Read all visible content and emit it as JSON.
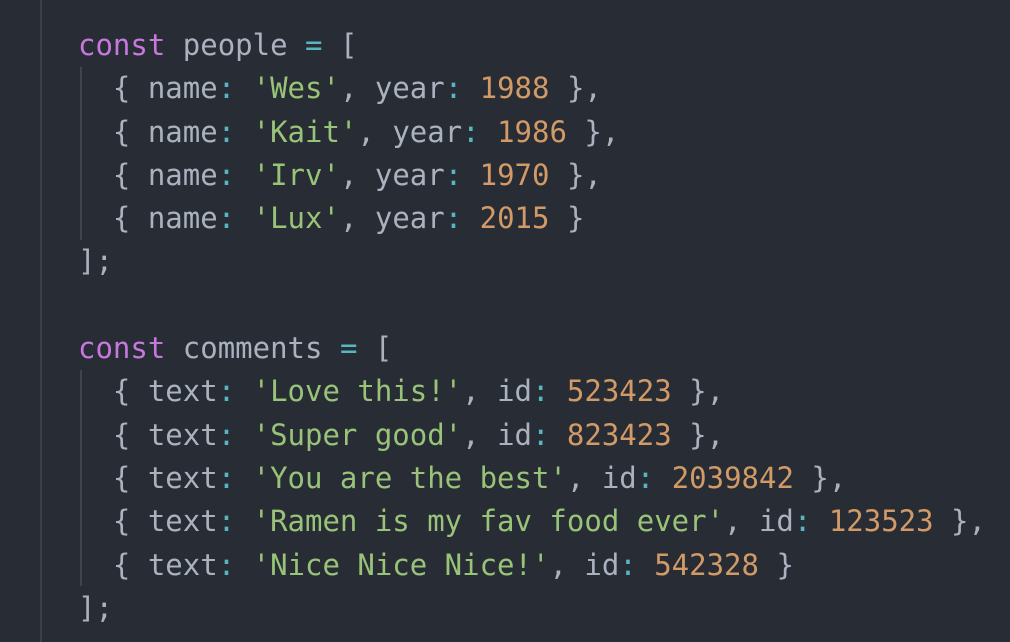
{
  "blocks": [
    {
      "keyword": "const",
      "name": "people",
      "op": "=",
      "open": "[",
      "close": "];",
      "key1": "name",
      "key2": "year",
      "items": [
        {
          "v1": "'Wes'",
          "v2": "1988",
          "end": " },"
        },
        {
          "v1": "'Kait'",
          "v2": "1986",
          "end": " },"
        },
        {
          "v1": "'Irv'",
          "v2": "1970",
          "end": " },"
        },
        {
          "v1": "'Lux'",
          "v2": "2015",
          "end": " }"
        }
      ]
    },
    {
      "keyword": "const",
      "name": "comments",
      "op": "=",
      "open": "[",
      "close": "];",
      "key1": "text",
      "key2": "id",
      "items": [
        {
          "v1": "'Love this!'",
          "v2": "523423",
          "end": " },"
        },
        {
          "v1": "'Super good'",
          "v2": "823423",
          "end": " },"
        },
        {
          "v1": "'You are the best'",
          "v2": "2039842",
          "end": " },"
        },
        {
          "v1": "'Ramen is my fav food ever'",
          "v2": "123523",
          "end": " },"
        },
        {
          "v1": "'Nice Nice Nice!'",
          "v2": "542328",
          "end": " }"
        }
      ]
    }
  ],
  "colors": {
    "background": "#282c34",
    "keyword": "#c678dd",
    "operator": "#56b6c2",
    "string": "#98c379",
    "number": "#d19a66",
    "text": "#abb2bf"
  }
}
